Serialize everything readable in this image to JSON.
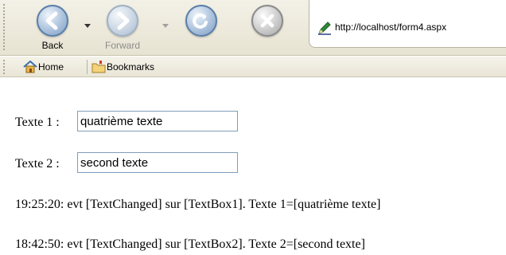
{
  "toolbar": {
    "back_label": "Back",
    "forward_label": "Forward",
    "address_url": "http://localhost/form4.aspx",
    "icons": {
      "back": "back-arrow-icon",
      "forward": "forward-arrow-icon",
      "refresh": "refresh-icon",
      "stop": "stop-icon",
      "page": "pencil-page-icon"
    }
  },
  "bookmarks_bar": {
    "home_label": "Home",
    "bookmarks_label": "Bookmarks"
  },
  "form": {
    "texte1_label": "Texte 1 :",
    "texte1_value": "quatrième texte",
    "texte2_label": "Texte 2 :",
    "texte2_value": "second texte"
  },
  "log": [
    "19:25:20: evt [TextChanged] sur [TextBox1]. Texte 1=[quatrième texte]",
    "18:42:50: evt [TextChanged] sur [TextBox2]. Texte 2=[second texte]"
  ],
  "colors": {
    "toolbar_bg": "#ece9d8",
    "button_blue": "#7c9cc2",
    "input_border": "#7f9db9"
  }
}
